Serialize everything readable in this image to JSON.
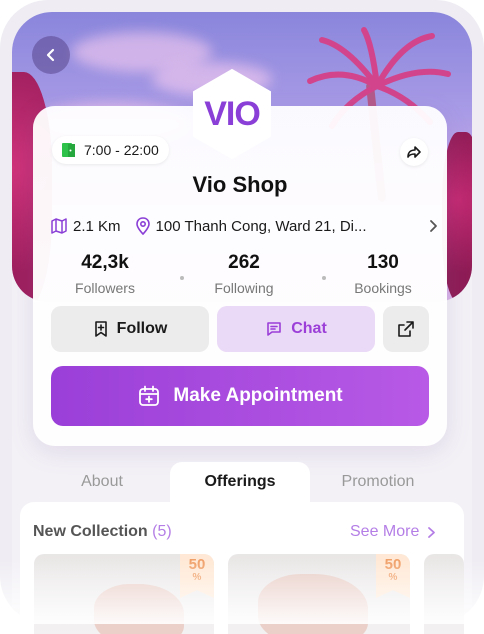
{
  "shop": {
    "logo_text": "VIO",
    "name": "Vio Shop",
    "hours": "7:00 - 22:00",
    "distance": "2.1 Km",
    "address": "100 Thanh Cong, Ward 21, Di..."
  },
  "stats": [
    {
      "value": "42,3k",
      "label": "Followers"
    },
    {
      "value": "262",
      "label": "Following"
    },
    {
      "value": "130",
      "label": "Bookings"
    }
  ],
  "actions": {
    "follow_label": "Follow",
    "chat_label": "Chat",
    "appointment_label": "Make Appointment"
  },
  "tabs": [
    {
      "label": "About",
      "active": false
    },
    {
      "label": "Offerings",
      "active": true
    },
    {
      "label": "Promotion",
      "active": false
    }
  ],
  "collection": {
    "title": "New Collection",
    "count": "(5)",
    "see_more": "See More",
    "items": [
      {
        "badge": "50",
        "badge_unit": "%"
      },
      {
        "badge": "50",
        "badge_unit": "%"
      }
    ]
  },
  "colors": {
    "accent": "#9b3fd8",
    "open_icon": "#2ec24a"
  },
  "icons": [
    "back-icon",
    "open-door-icon",
    "share-icon",
    "map-icon",
    "location-pin-icon",
    "chevron-right-icon",
    "follow-bookmark-icon",
    "chat-icon",
    "external-link-icon",
    "calendar-add-icon"
  ]
}
